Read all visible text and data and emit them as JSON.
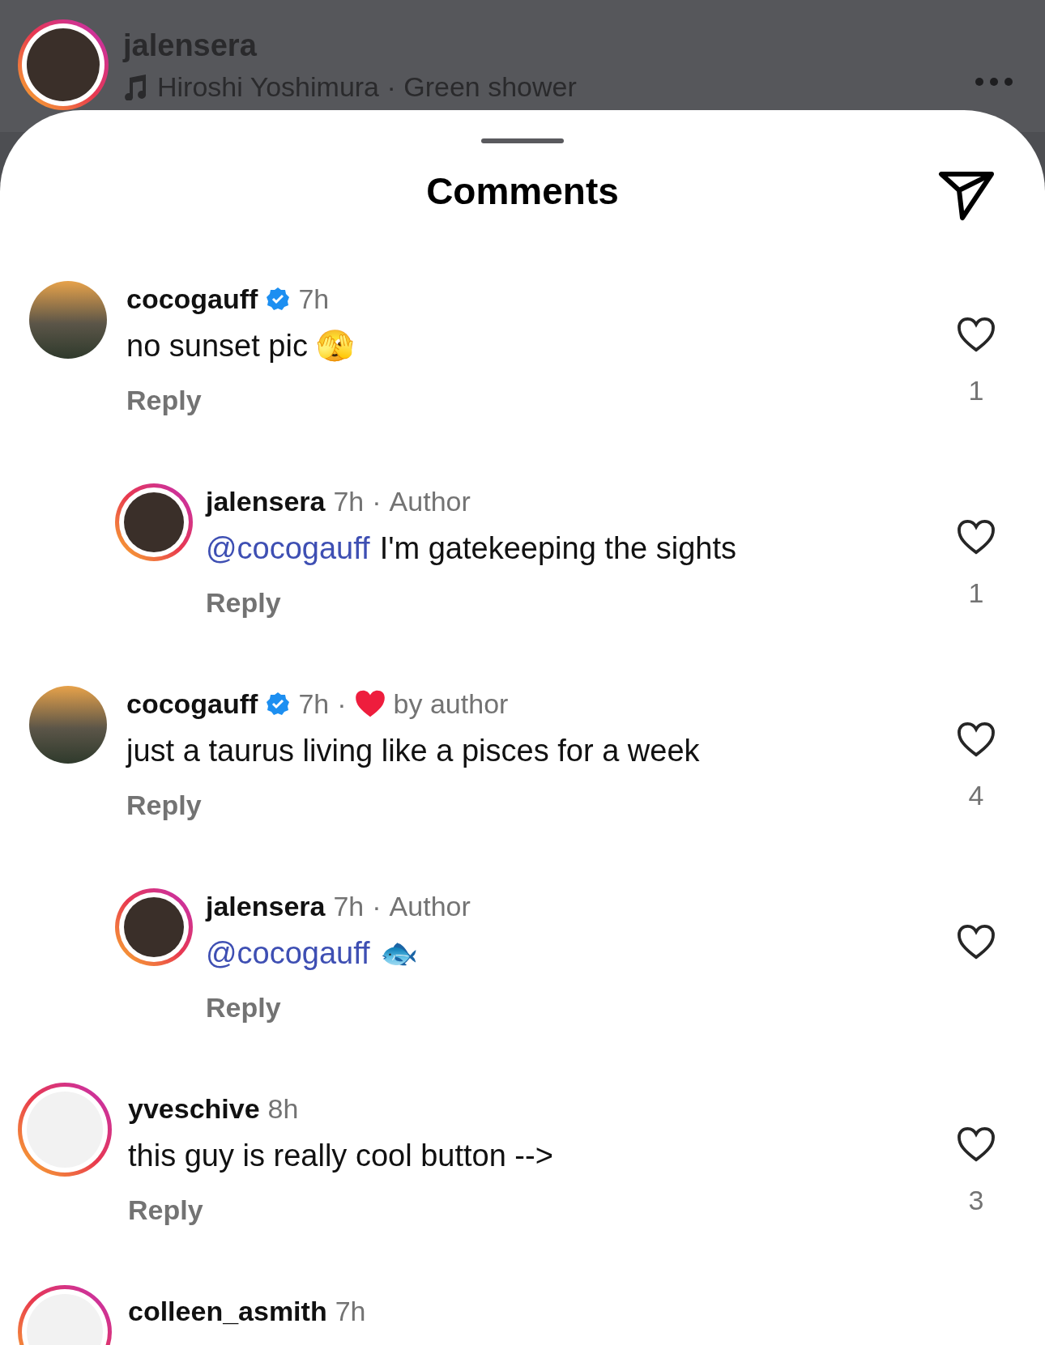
{
  "header": {
    "username": "jalensera",
    "audio": "Hiroshi Yoshimura · Green shower",
    "story_ring": true
  },
  "sheet": {
    "title": "Comments"
  },
  "comments": [
    {
      "username": "cocogauff",
      "verified": true,
      "time": "7h",
      "author": false,
      "liked_by_author": false,
      "reply_to": false,
      "story_ring": false,
      "text": "no sunset pic 🫣",
      "reply": "Reply",
      "likes": "1"
    },
    {
      "username": "jalensera",
      "verified": false,
      "time": "7h",
      "separator": "·",
      "author": true,
      "author_label": "Author",
      "liked_by_author": false,
      "reply_to": true,
      "story_ring": true,
      "mention": "@cocogauff",
      "text": "I'm gatekeeping the sights",
      "reply": "Reply",
      "likes": "1"
    },
    {
      "username": "cocogauff",
      "verified": true,
      "time": "7h",
      "separator": "·",
      "author": false,
      "liked_by_author": true,
      "liked_label": "by author",
      "reply_to": false,
      "story_ring": false,
      "text": "just a taurus living like a pisces for a week",
      "reply": "Reply",
      "likes": "4"
    },
    {
      "username": "jalensera",
      "verified": false,
      "time": "7h",
      "separator": "·",
      "author": true,
      "author_label": "Author",
      "liked_by_author": false,
      "reply_to": true,
      "story_ring": true,
      "mention": "@cocogauff",
      "text": "🐟",
      "reply": "Reply"
    },
    {
      "username": "yveschive",
      "verified": false,
      "time": "8h",
      "author": false,
      "liked_by_author": false,
      "reply_to": false,
      "story_ring": true,
      "text": "this guy is really cool button -->",
      "reply": "Reply",
      "likes": "3"
    },
    {
      "username": "colleen_asmith",
      "verified": false,
      "time": "7h",
      "author": false,
      "liked_by_author": false,
      "reply_to": false,
      "story_ring": true,
      "partial": true
    }
  ]
}
